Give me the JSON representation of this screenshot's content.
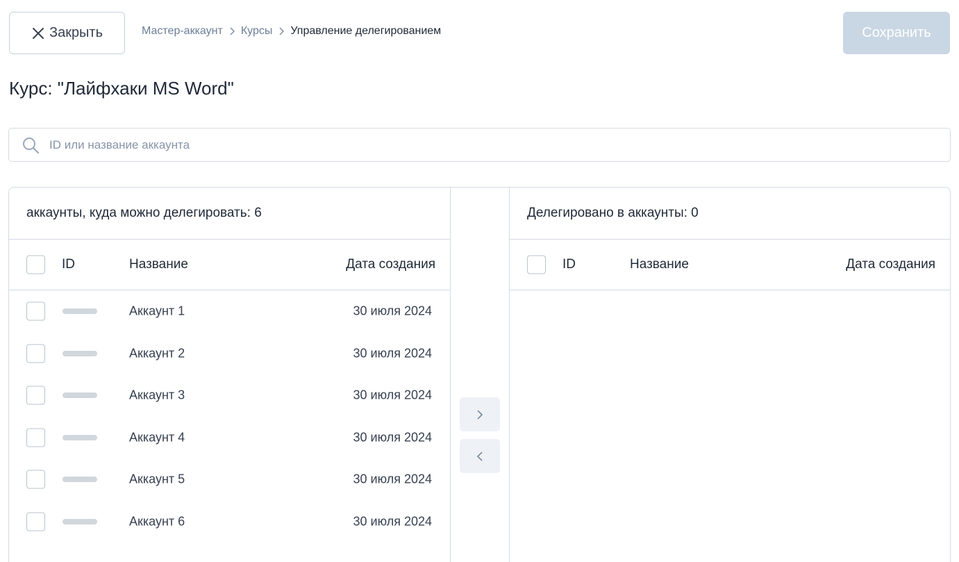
{
  "header": {
    "close_label": "Закрыть",
    "breadcrumb": [
      "Мастер-аккаунт",
      "Курсы",
      "Управление делегированием"
    ],
    "save_label": "Сохранить"
  },
  "course": {
    "title": "Курс: \"Лайфхаки MS Word\""
  },
  "search": {
    "placeholder": "ID или название аккаунта",
    "value": ""
  },
  "left_panel": {
    "title": "аккаунты, куда можно делегировать: 6",
    "columns": {
      "id": "ID",
      "name": "Название",
      "date": "Дата создания"
    },
    "rows": [
      {
        "name": "Аккаунт 1",
        "date": "30 июля 2024"
      },
      {
        "name": "Аккаунт 2",
        "date": "30 июля 2024"
      },
      {
        "name": "Аккаунт 3",
        "date": "30 июля 2024"
      },
      {
        "name": "Аккаунт 4",
        "date": "30 июля 2024"
      },
      {
        "name": "Аккаунт 5",
        "date": "30 июля 2024"
      },
      {
        "name": "Аккаунт 6",
        "date": "30 июля 2024"
      }
    ]
  },
  "right_panel": {
    "title": "Делегировано в аккаунты: 0",
    "columns": {
      "id": "ID",
      "name": "Название",
      "date": "Дата создания"
    }
  },
  "icons": {
    "close": "close-icon",
    "search": "search-icon",
    "chevron": "chevron-right-icon",
    "move_right": "chevron-right-icon",
    "move_left": "chevron-left-icon"
  },
  "colors": {
    "save_disabled_bg": "#c9d6e3",
    "border": "#d5dbe3",
    "muted_text": "#6b7e98"
  }
}
